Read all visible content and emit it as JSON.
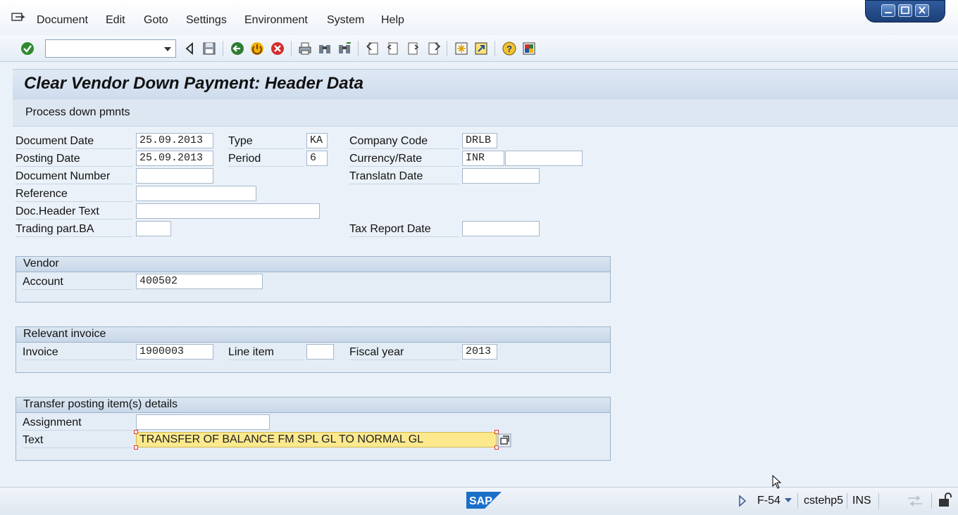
{
  "menu": {
    "items": [
      "Document",
      "Edit",
      "Goto",
      "Settings",
      "Environment",
      "System",
      "Help"
    ]
  },
  "toolbar": {
    "command_field_value": ""
  },
  "page": {
    "title": "Clear Vendor Down Payment: Header Data",
    "app_button": "Process down pmnts"
  },
  "header": {
    "document_date_label": "Document Date",
    "document_date": "25.09.2013",
    "type_label": "Type",
    "type": "KA",
    "company_code_label": "Company Code",
    "company_code": "DRLB",
    "posting_date_label": "Posting Date",
    "posting_date": "25.09.2013",
    "period_label": "Period",
    "period": "6",
    "currency_label": "Currency/Rate",
    "currency": "INR",
    "rate": "",
    "document_number_label": "Document Number",
    "document_number": "",
    "translation_date_label": "Translatn Date",
    "translation_date": "",
    "reference_label": "Reference",
    "reference": "",
    "doc_header_text_label": "Doc.Header Text",
    "doc_header_text": "",
    "trading_part_label": "Trading part.BA",
    "trading_part": "",
    "tax_report_date_label": "Tax Report Date",
    "tax_report_date": ""
  },
  "vendor": {
    "group_title": "Vendor",
    "account_label": "Account",
    "account": "400502"
  },
  "invoice": {
    "group_title": "Relevant invoice",
    "invoice_label": "Invoice",
    "invoice": "1900003",
    "line_item_label": "Line item",
    "line_item": "",
    "fiscal_year_label": "Fiscal year",
    "fiscal_year": "2013"
  },
  "transfer": {
    "group_title": "Transfer posting item(s) details",
    "assignment_label": "Assignment",
    "assignment": "",
    "text_label": "Text",
    "text": "TRANSFER OF BALANCE FM SPL GL TO NORMAL GL"
  },
  "status": {
    "transaction": "F-54",
    "server": "cstehp5",
    "mode": "INS",
    "logo": "SAP"
  },
  "colors": {
    "accent": "#1c3f78",
    "highlight": "#fce98e"
  }
}
